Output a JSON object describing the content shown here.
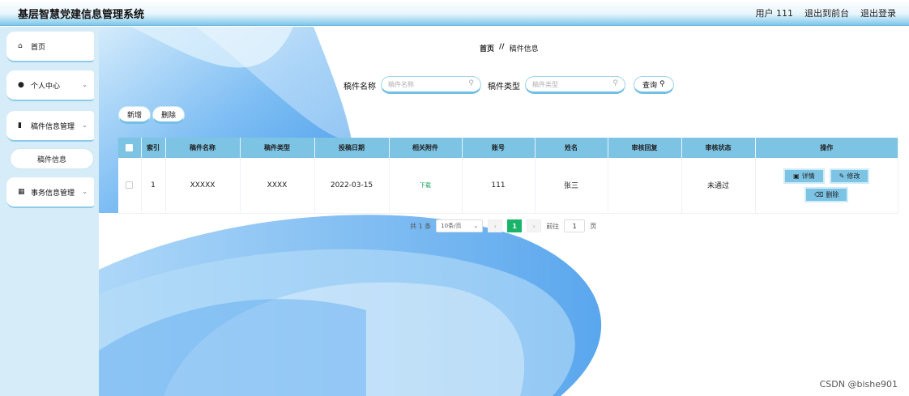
{
  "header": {
    "title": "基层智慧党建信息管理系统",
    "user_label": "用户 111",
    "back_front": "退出到前台",
    "logout": "退出登录"
  },
  "sidebar": {
    "items": [
      {
        "label": "首页",
        "icon": "home-icon"
      },
      {
        "label": "个人中心",
        "icon": "user-icon"
      },
      {
        "label": "稿件信息管理",
        "icon": "document-icon"
      },
      {
        "label": "稿件信息",
        "icon": ""
      },
      {
        "label": "事务信息管理",
        "icon": "grid-icon"
      }
    ]
  },
  "breadcrumb": {
    "home": "首页",
    "sep": "//",
    "current": "稿件信息"
  },
  "search": {
    "name_label": "稿件名称",
    "name_placeholder": "稿件名称",
    "type_label": "稿件类型",
    "type_placeholder": "稿件类型",
    "query_button": "查询"
  },
  "actions": {
    "add": "新增",
    "delete": "删除"
  },
  "table": {
    "columns": [
      "索引",
      "稿件名称",
      "稿件类型",
      "投稿日期",
      "相关附件",
      "账号",
      "姓名",
      "审核回复",
      "审核状态",
      "操作"
    ],
    "rows": [
      {
        "index": "1",
        "name": "XXXXX",
        "type": "XXXX",
        "date": "2022-03-15",
        "attachment": "下载",
        "account": "111",
        "person": "张三",
        "reply": "",
        "status": "未通过",
        "ops": {
          "detail": "详情",
          "edit": "修改",
          "delete": "删除"
        }
      }
    ]
  },
  "pagination": {
    "total": "共 1 条",
    "page_size": "10条/页",
    "prev": "‹",
    "current": "1",
    "next": "›",
    "goto_label": "前往",
    "goto_value": "1",
    "page_suffix": "页"
  },
  "watermark": "CSDN @bishe901",
  "colors": {
    "accent": "#7cc3e4",
    "sidebar_bg": "#d6ecf8",
    "pager_active": "#19b46a",
    "download_link": "#1aa05a"
  }
}
